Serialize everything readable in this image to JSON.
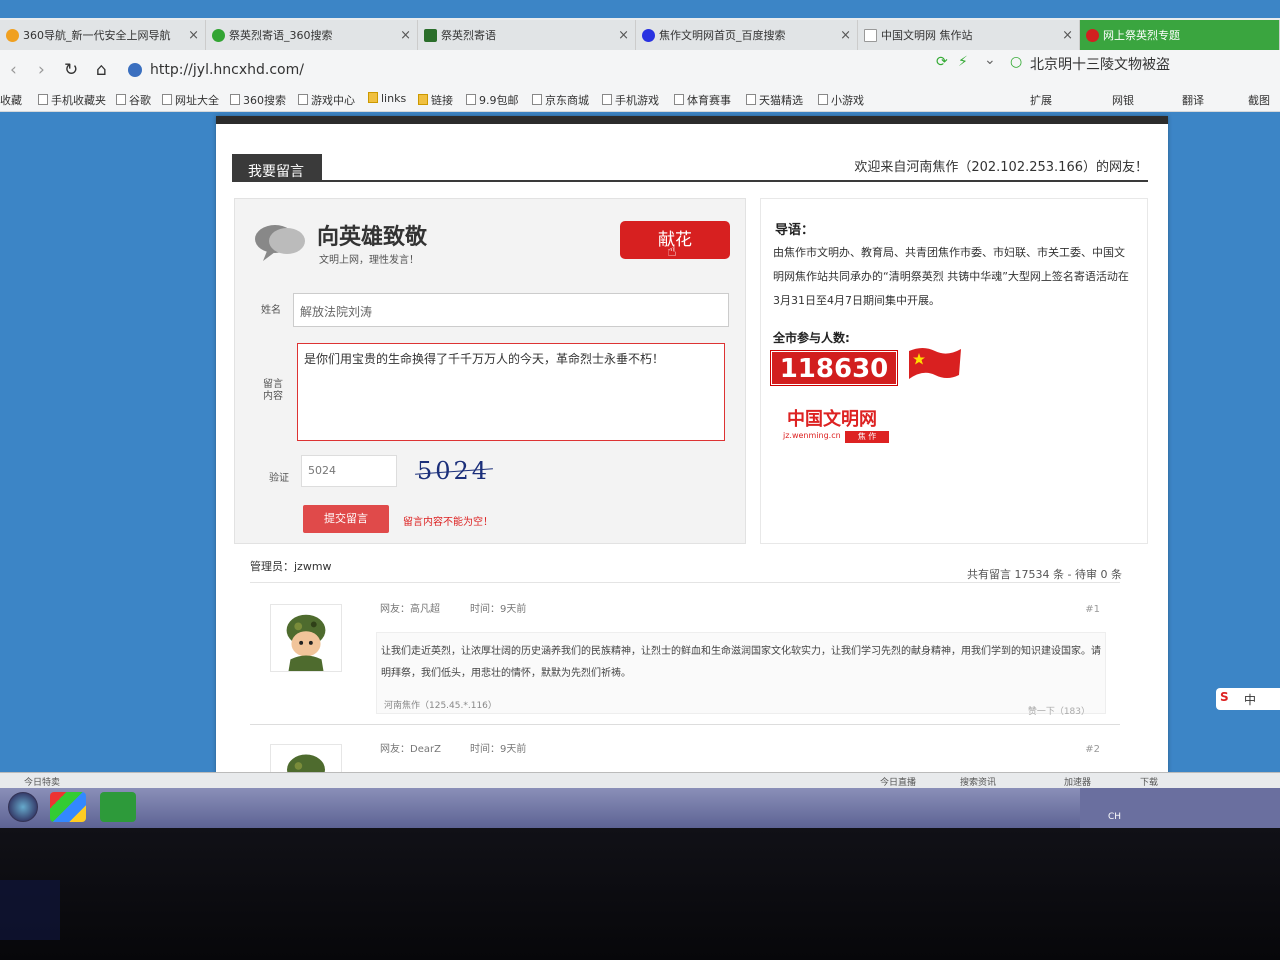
{
  "browser": {
    "tabs": [
      {
        "label": "360导航_新一代安全上网导航",
        "icon": "360-icon",
        "color": "#f0a020"
      },
      {
        "label": "祭英烈寄语_360搜索",
        "icon": "360-search-icon",
        "color": "#33a534"
      },
      {
        "label": "祭英烈寄语",
        "icon": "page-icon",
        "color": "#2b6e2b"
      },
      {
        "label": "焦作文明网首页_百度搜索",
        "icon": "baidu-paw-icon",
        "color": "#2932e1"
      },
      {
        "label": "中国文明网 焦作站",
        "icon": "page-icon",
        "color": "#999999"
      },
      {
        "label": "网上祭英烈专题",
        "icon": "active-page-icon",
        "color": "#d22020"
      }
    ],
    "close_glyph": "×",
    "url": "http://jyl.hncxhd.com/",
    "search_text": "北京明十三陵文物被盗",
    "bookmarks": [
      "收藏",
      "手机收藏夹",
      "谷歌",
      "网址大全",
      "360搜索",
      "游戏中心",
      "links",
      "链接",
      "9.9包邮",
      "京东商城",
      "手机游戏",
      "体育赛事",
      "天猫精选",
      "小游戏"
    ],
    "extensions": [
      "扩展",
      "网银",
      "翻译",
      "截图"
    ]
  },
  "page": {
    "tab_label": "我要留言",
    "welcome": "欢迎来自河南焦作（202.102.253.166）的网友！",
    "form": {
      "title": "向英雄致敬",
      "subtitle": "文明上网，理性发言！",
      "flower_button": "献花",
      "name_label": "姓名",
      "name_value": "解放法院刘涛",
      "content_label": "留言内容",
      "content_value": "是你们用宝贵的生命换得了千千万万人的今天，革命烈士永垂不朽！",
      "verify_label": "验证",
      "verify_value": "5024",
      "captcha": "5024",
      "submit_button": "提交留言",
      "error": "留言内容不能为空！"
    },
    "intro": {
      "title": "导语：",
      "text": "由焦作市文明办、教育局、共青团焦作市委、市妇联、市关工委、中国文明网焦作站共同承办的“清明祭英烈 共铸中华魂”大型网上签名寄语活动在3月31日至4月7日期间集中开展。",
      "count_label": "全市参与人数:",
      "count": "118630",
      "logo_main": "中国文明网",
      "logo_domain": "jz.wenming.cn",
      "logo_city": "焦 作"
    },
    "admin": "管理员：jzwmw",
    "total": "共有留言 17534 条 - 待审 0 条",
    "messages": [
      {
        "user": "网友：高凡超",
        "time": "时间：9天前",
        "num": "#1",
        "body": "让我们走近英烈，让浓厚壮阔的历史涵养我们的民族精神，让烈士的鲜血和生命滋润国家文化软实力，让我们学习先烈的献身精神，用我们学到的知识建设国家。请明拜祭，我们低头，用悲壮的情怀，默默为先烈们祈祷。",
        "ip": "河南焦作（125.45.*.116）",
        "like": "赞一下（183）"
      },
      {
        "user": "网友：DearZ",
        "time": "时间：9天前",
        "num": "#2",
        "body": "",
        "ip": "",
        "like": ""
      }
    ]
  },
  "status": {
    "left": "今日特卖",
    "items": [
      "今日直播",
      "搜索资讯",
      "加速器",
      "下载"
    ]
  },
  "taskbar": {
    "lang": "CH"
  },
  "ime": {
    "label": "中"
  }
}
